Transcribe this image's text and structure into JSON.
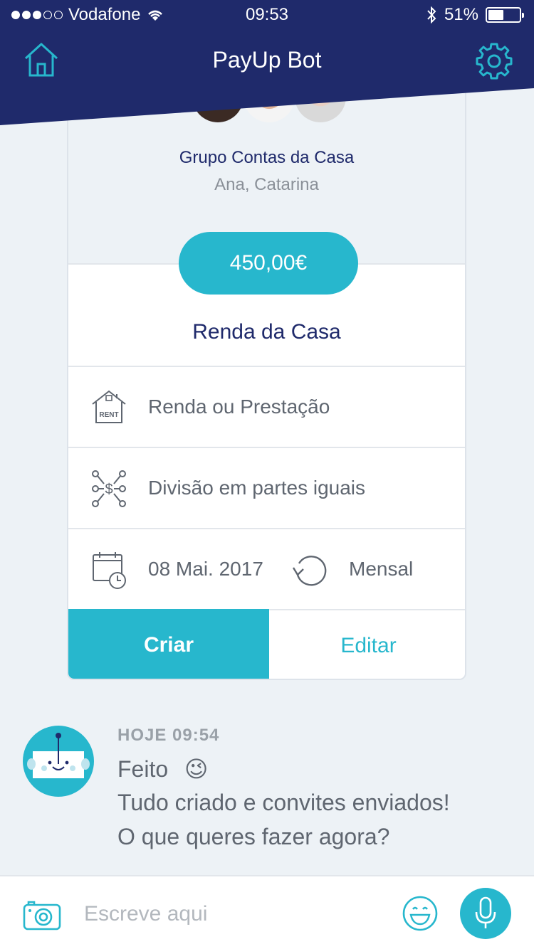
{
  "status_bar": {
    "carrier": "Vodafone",
    "time": "09:53",
    "battery": "51%",
    "battery_level": 0.51,
    "signal_filled": 3,
    "signal_total": 5
  },
  "header": {
    "title": "PayUp Bot",
    "home_icon": "home-icon",
    "settings_icon": "gear-icon",
    "background_color": "#1f2a6b"
  },
  "group": {
    "name": "Grupo Contas da Casa",
    "members": "Ana, Catarina"
  },
  "bill": {
    "amount": "450,00€",
    "name": "Renda da Casa",
    "category": "Renda ou Prestação",
    "split": "Divisão em partes iguais",
    "date": "08 Mai. 2017",
    "recurrence": "Mensal"
  },
  "actions": {
    "create": "Criar",
    "edit": "Editar"
  },
  "message": {
    "time": "HOJE 09:54",
    "line1": "Feito",
    "emoji": "😉",
    "line2": "Tudo criado e convites enviados!",
    "line3": "O que queres fazer agora?"
  },
  "input": {
    "placeholder": "Escreve aqui",
    "value": ""
  },
  "colors": {
    "accent": "#27b7cd",
    "navy": "#1f2a6b",
    "background": "#edf2f6"
  }
}
